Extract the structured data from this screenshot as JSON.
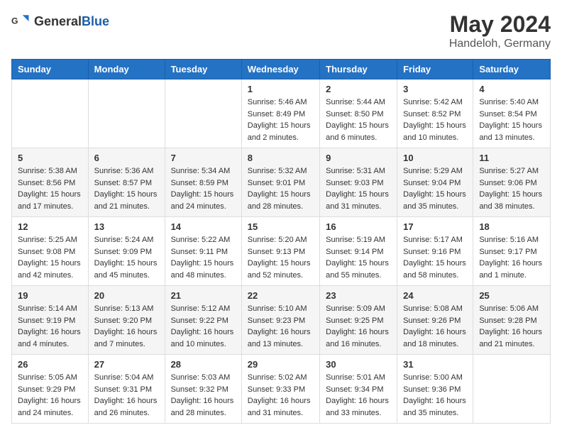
{
  "header": {
    "logo_general": "General",
    "logo_blue": "Blue",
    "month": "May 2024",
    "location": "Handeloh, Germany"
  },
  "days_of_week": [
    "Sunday",
    "Monday",
    "Tuesday",
    "Wednesday",
    "Thursday",
    "Friday",
    "Saturday"
  ],
  "weeks": [
    [
      {
        "day": "",
        "info": ""
      },
      {
        "day": "",
        "info": ""
      },
      {
        "day": "",
        "info": ""
      },
      {
        "day": "1",
        "info": "Sunrise: 5:46 AM\nSunset: 8:49 PM\nDaylight: 15 hours\nand 2 minutes."
      },
      {
        "day": "2",
        "info": "Sunrise: 5:44 AM\nSunset: 8:50 PM\nDaylight: 15 hours\nand 6 minutes."
      },
      {
        "day": "3",
        "info": "Sunrise: 5:42 AM\nSunset: 8:52 PM\nDaylight: 15 hours\nand 10 minutes."
      },
      {
        "day": "4",
        "info": "Sunrise: 5:40 AM\nSunset: 8:54 PM\nDaylight: 15 hours\nand 13 minutes."
      }
    ],
    [
      {
        "day": "5",
        "info": "Sunrise: 5:38 AM\nSunset: 8:56 PM\nDaylight: 15 hours\nand 17 minutes."
      },
      {
        "day": "6",
        "info": "Sunrise: 5:36 AM\nSunset: 8:57 PM\nDaylight: 15 hours\nand 21 minutes."
      },
      {
        "day": "7",
        "info": "Sunrise: 5:34 AM\nSunset: 8:59 PM\nDaylight: 15 hours\nand 24 minutes."
      },
      {
        "day": "8",
        "info": "Sunrise: 5:32 AM\nSunset: 9:01 PM\nDaylight: 15 hours\nand 28 minutes."
      },
      {
        "day": "9",
        "info": "Sunrise: 5:31 AM\nSunset: 9:03 PM\nDaylight: 15 hours\nand 31 minutes."
      },
      {
        "day": "10",
        "info": "Sunrise: 5:29 AM\nSunset: 9:04 PM\nDaylight: 15 hours\nand 35 minutes."
      },
      {
        "day": "11",
        "info": "Sunrise: 5:27 AM\nSunset: 9:06 PM\nDaylight: 15 hours\nand 38 minutes."
      }
    ],
    [
      {
        "day": "12",
        "info": "Sunrise: 5:25 AM\nSunset: 9:08 PM\nDaylight: 15 hours\nand 42 minutes."
      },
      {
        "day": "13",
        "info": "Sunrise: 5:24 AM\nSunset: 9:09 PM\nDaylight: 15 hours\nand 45 minutes."
      },
      {
        "day": "14",
        "info": "Sunrise: 5:22 AM\nSunset: 9:11 PM\nDaylight: 15 hours\nand 48 minutes."
      },
      {
        "day": "15",
        "info": "Sunrise: 5:20 AM\nSunset: 9:13 PM\nDaylight: 15 hours\nand 52 minutes."
      },
      {
        "day": "16",
        "info": "Sunrise: 5:19 AM\nSunset: 9:14 PM\nDaylight: 15 hours\nand 55 minutes."
      },
      {
        "day": "17",
        "info": "Sunrise: 5:17 AM\nSunset: 9:16 PM\nDaylight: 15 hours\nand 58 minutes."
      },
      {
        "day": "18",
        "info": "Sunrise: 5:16 AM\nSunset: 9:17 PM\nDaylight: 16 hours\nand 1 minute."
      }
    ],
    [
      {
        "day": "19",
        "info": "Sunrise: 5:14 AM\nSunset: 9:19 PM\nDaylight: 16 hours\nand 4 minutes."
      },
      {
        "day": "20",
        "info": "Sunrise: 5:13 AM\nSunset: 9:20 PM\nDaylight: 16 hours\nand 7 minutes."
      },
      {
        "day": "21",
        "info": "Sunrise: 5:12 AM\nSunset: 9:22 PM\nDaylight: 16 hours\nand 10 minutes."
      },
      {
        "day": "22",
        "info": "Sunrise: 5:10 AM\nSunset: 9:23 PM\nDaylight: 16 hours\nand 13 minutes."
      },
      {
        "day": "23",
        "info": "Sunrise: 5:09 AM\nSunset: 9:25 PM\nDaylight: 16 hours\nand 16 minutes."
      },
      {
        "day": "24",
        "info": "Sunrise: 5:08 AM\nSunset: 9:26 PM\nDaylight: 16 hours\nand 18 minutes."
      },
      {
        "day": "25",
        "info": "Sunrise: 5:06 AM\nSunset: 9:28 PM\nDaylight: 16 hours\nand 21 minutes."
      }
    ],
    [
      {
        "day": "26",
        "info": "Sunrise: 5:05 AM\nSunset: 9:29 PM\nDaylight: 16 hours\nand 24 minutes."
      },
      {
        "day": "27",
        "info": "Sunrise: 5:04 AM\nSunset: 9:31 PM\nDaylight: 16 hours\nand 26 minutes."
      },
      {
        "day": "28",
        "info": "Sunrise: 5:03 AM\nSunset: 9:32 PM\nDaylight: 16 hours\nand 28 minutes."
      },
      {
        "day": "29",
        "info": "Sunrise: 5:02 AM\nSunset: 9:33 PM\nDaylight: 16 hours\nand 31 minutes."
      },
      {
        "day": "30",
        "info": "Sunrise: 5:01 AM\nSunset: 9:34 PM\nDaylight: 16 hours\nand 33 minutes."
      },
      {
        "day": "31",
        "info": "Sunrise: 5:00 AM\nSunset: 9:36 PM\nDaylight: 16 hours\nand 35 minutes."
      },
      {
        "day": "",
        "info": ""
      }
    ]
  ]
}
